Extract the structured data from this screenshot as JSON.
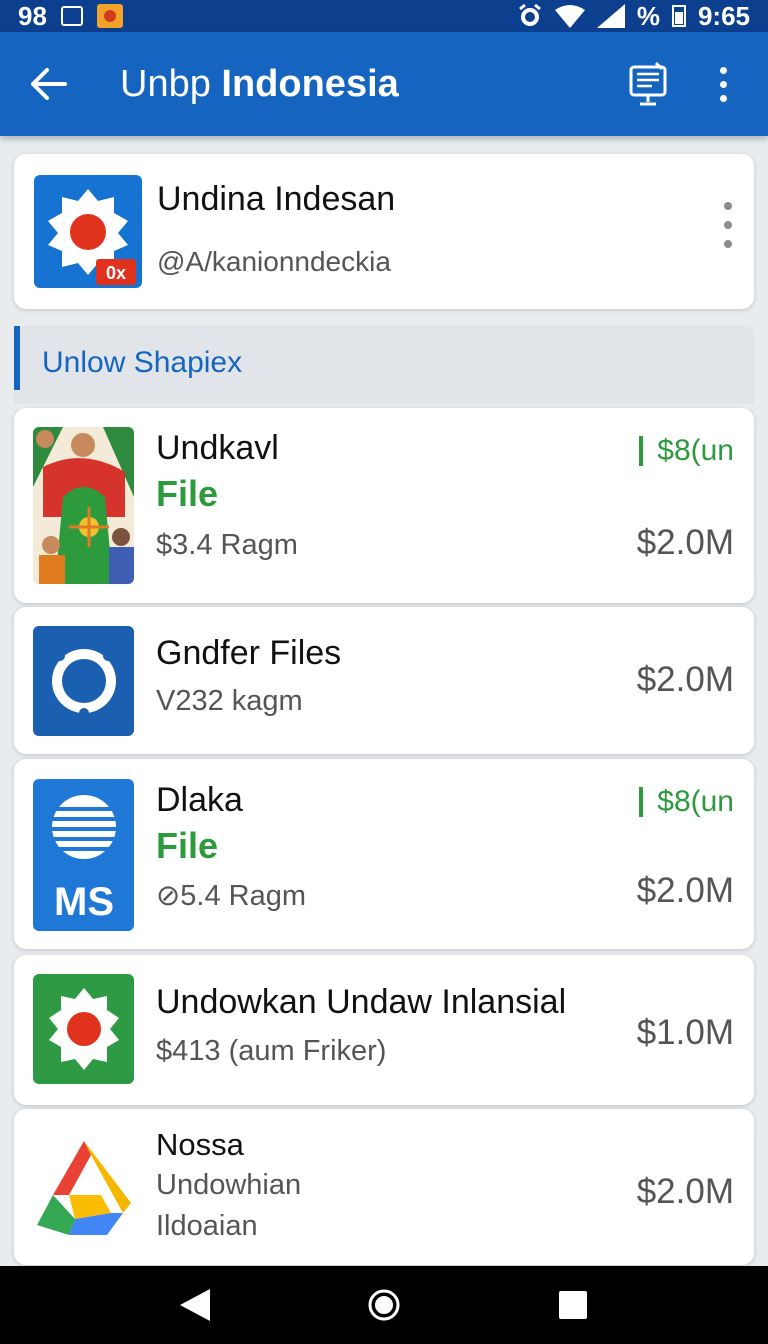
{
  "status_bar": {
    "left_text": "98",
    "battery_text": "%",
    "time": "9:65"
  },
  "app_bar": {
    "title_light": "Unbp",
    "title_bold": "Indonesia",
    "back_icon": "arrow-back-icon",
    "action_icon": "receipt-monitor-icon",
    "menu_icon": "more-vert-icon"
  },
  "header_card": {
    "title": "Undina Indesan",
    "subtitle": "@A/kanionndeckia",
    "icon_badge": "0x",
    "icon_color": "#1673d1"
  },
  "section": {
    "label": "Unlow Shapiex"
  },
  "items": [
    {
      "title": "Undkavl",
      "green_label": "File",
      "subtitle": "$3.4 Ragm",
      "badge": "$8(un",
      "amount": "$2.0M",
      "icon": "illustration-people-icon"
    },
    {
      "title": "Gndfer Files",
      "subtitle": "V232 kagm",
      "amount": "$2.0M",
      "icon": "ring-icon"
    },
    {
      "title": "Dlaka",
      "green_label": "File",
      "subtitle": "⊘5.4 Ragm",
      "badge": "$8(un",
      "amount": "$2.0M",
      "icon_text": "MS",
      "icon": "ms-globe-icon"
    },
    {
      "title": "Undowkan  Undaw Inlansial",
      "subtitle": "$413  (aum Friker)",
      "amount": "$1.0M",
      "icon": "gear-sun-icon"
    },
    {
      "title": "Nossa",
      "subtitle_line1": "Undowhian",
      "subtitle_line2": "Ildoaian",
      "amount": "$2.0M",
      "icon": "drive-triangle-icon"
    }
  ],
  "colors": {
    "app_bar": "#1565c0",
    "status_bar": "#0d3f8f",
    "accent_green": "#2e9a3e"
  }
}
